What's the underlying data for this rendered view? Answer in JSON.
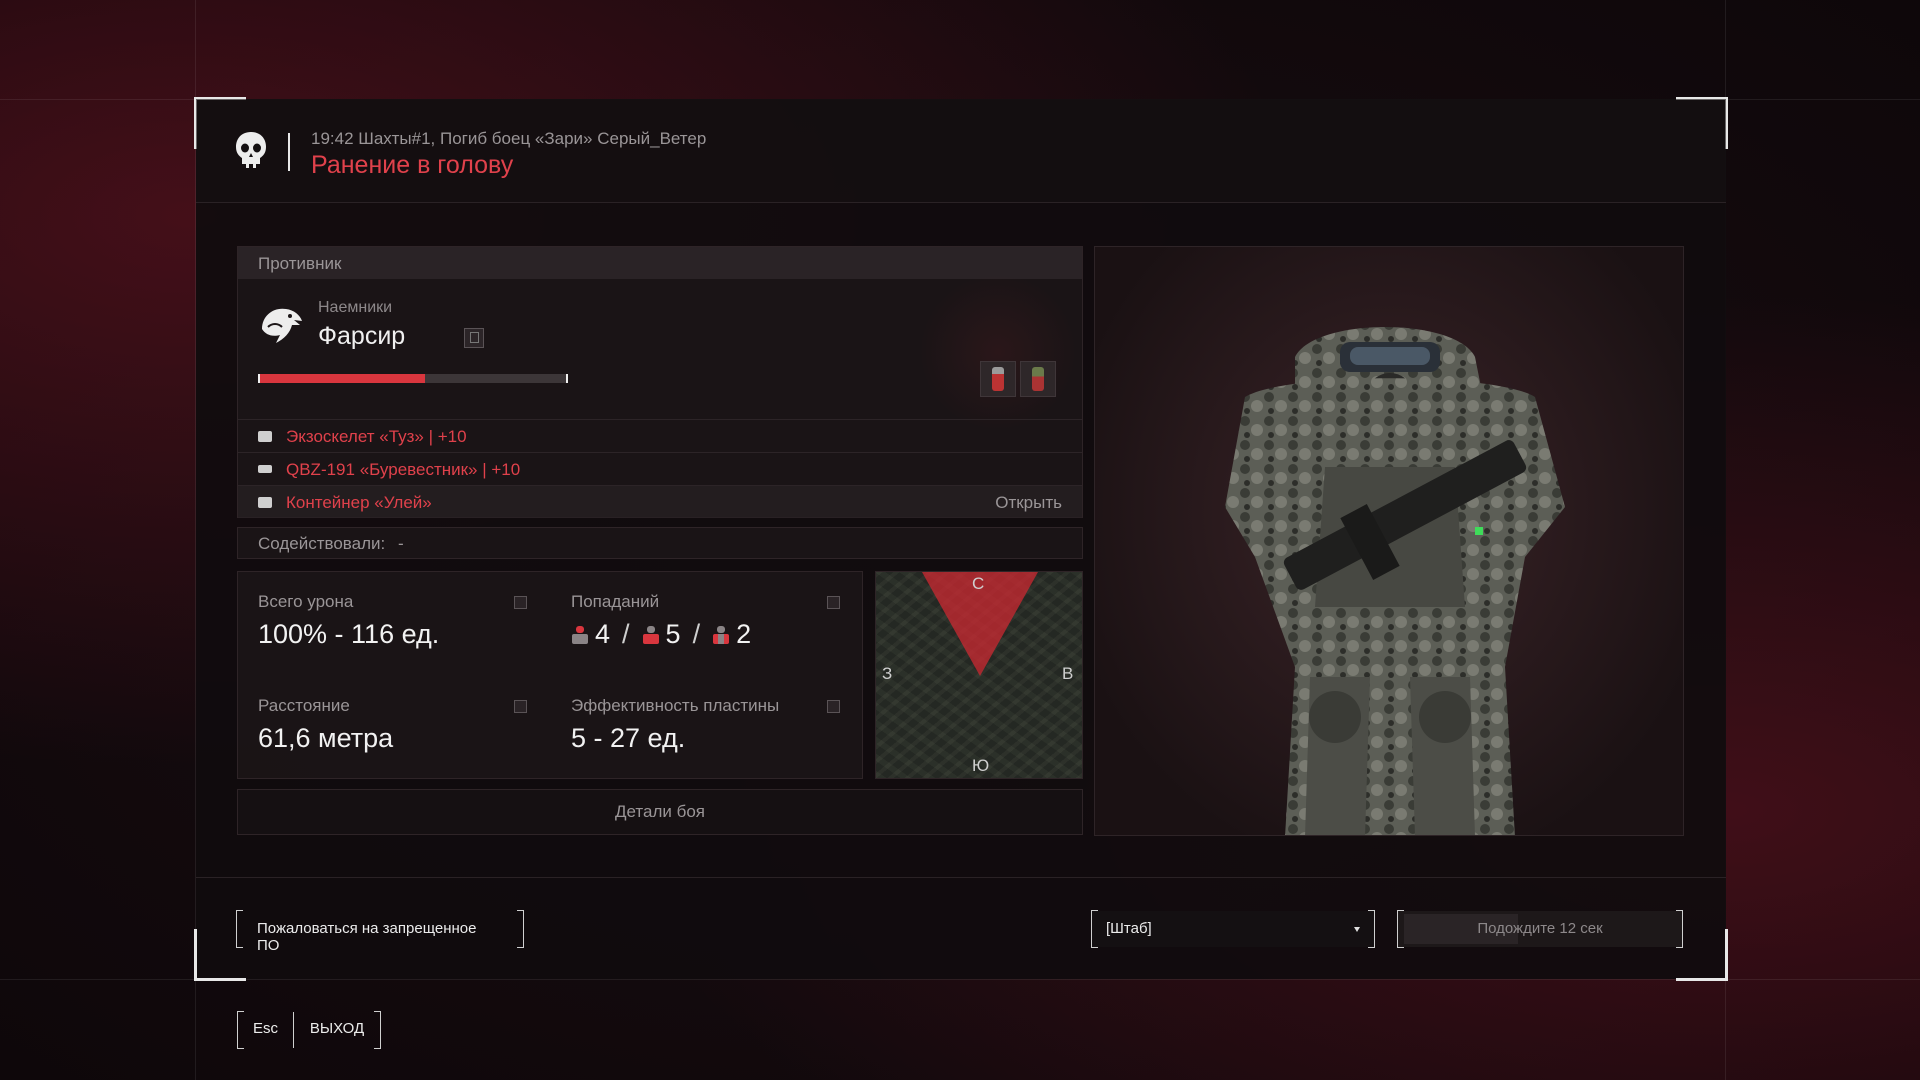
{
  "header": {
    "meta": "19:42 Шахты#1, Погиб боец «Зари» Серый_Ветер",
    "title": "Ранение в голову"
  },
  "enemy": {
    "section_label": "Противник",
    "faction": "Наемники",
    "name": "Фарсир",
    "hp_fraction": 0.54,
    "hp_color": "#d9363e",
    "consumables": [
      "bottle-icon",
      "can-icon"
    ]
  },
  "loot": [
    {
      "icon": "armor-icon",
      "label": "Экзоскелет «Туз» | +10"
    },
    {
      "icon": "rifle-icon",
      "label": "QBZ-191 «Буревестник» | +10"
    },
    {
      "icon": "container-icon",
      "label": "Контейнер «Улей»",
      "action": "Открыть"
    }
  ],
  "assist": {
    "label": "Содействовали:",
    "value": "-"
  },
  "stats": {
    "damage": {
      "label": "Всего урона",
      "value": "100% - 116 ед."
    },
    "hits": {
      "label": "Попаданий",
      "head": "4",
      "body": "5",
      "limbs": "2"
    },
    "distance": {
      "label": "Расстояние",
      "value": "61,6 метра"
    },
    "plate": {
      "label": "Эффективность пластины",
      "value": "5 - 27 ед."
    }
  },
  "minimap": {
    "north": "С",
    "east": "В",
    "south": "Ю",
    "west": "З"
  },
  "details_button": "Детали боя",
  "footer": {
    "report_button": "Пожаловаться на запрещенное ПО",
    "channel_select": "[Штаб]",
    "wait_button": "Подождите 12 сек"
  },
  "exit": {
    "key": "Esc",
    "label": "ВЫХОД"
  },
  "colors": {
    "accent_red": "#e0414b",
    "panel_bg": "#1c1618"
  }
}
